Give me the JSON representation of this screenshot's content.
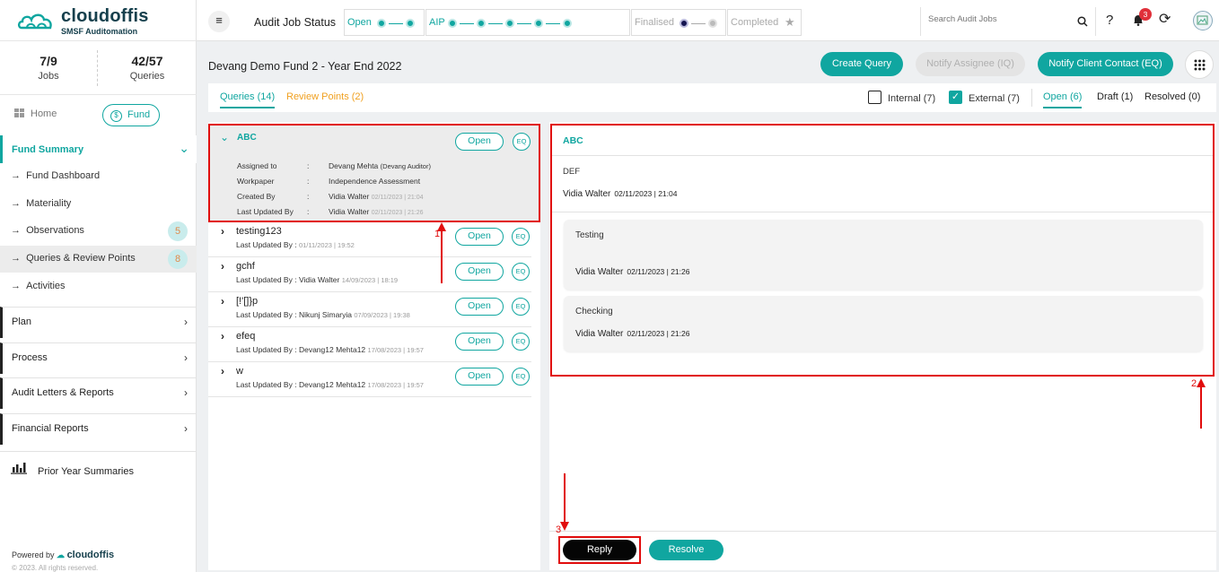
{
  "brand": {
    "name": "cloudoffis",
    "tagline": "SMSF Auditomation",
    "accent": "#10a6a0"
  },
  "sidebar": {
    "stats": [
      {
        "value": "7/9",
        "label": "Jobs"
      },
      {
        "value": "42/57",
        "label": "Queries"
      }
    ],
    "home_label": "Home",
    "fund_label": "Fund",
    "fund_summary_label": "Fund Summary",
    "sub_items": [
      {
        "label": "Fund Dashboard"
      },
      {
        "label": "Materiality"
      },
      {
        "label": "Observations",
        "count": "5"
      },
      {
        "label": "Queries & Review Points",
        "count": "8"
      },
      {
        "label": "Activities"
      }
    ],
    "sections": [
      {
        "label": "Plan"
      },
      {
        "label": "Process"
      },
      {
        "label": "Audit Letters & Reports"
      },
      {
        "label": "Financial Reports"
      }
    ],
    "prior_label": "Prior Year Summaries",
    "powered_by": "Powered by",
    "copyright": "© 2023. All rights reserved."
  },
  "topbar": {
    "title": "Audit Job Status",
    "stages": [
      "Open",
      "AIP",
      "Finalised",
      "Completed"
    ],
    "search_placeholder": "Search Audit Jobs",
    "notification_count": "3"
  },
  "page": {
    "title": "Devang Demo Fund 2 - Year End 2022",
    "buttons": {
      "create": "Create Query",
      "notify_assignee": "Notify Assignee (IQ)",
      "notify_client": "Notify Client Contact (EQ)"
    },
    "tabs": {
      "queries": "Queries (14)",
      "review": "Review Points (2)"
    },
    "filters": {
      "internal": "Internal (7)",
      "external": "External (7)",
      "open": "Open (6)",
      "draft": "Draft (1)",
      "resolved": "Resolved (0)"
    }
  },
  "list": {
    "open_label": "Open",
    "eq_label": "EQ",
    "expanded": {
      "title": "ABC",
      "fields": [
        {
          "label": "Assigned to",
          "value": "Devang Mehta",
          "extra": "(Devang Auditor)"
        },
        {
          "label": "Workpaper",
          "value": "Independence Assessment",
          "extra": ""
        },
        {
          "label": "Created By",
          "value": "Vidia Walter",
          "ts": "02/11/2023 | 21:04"
        },
        {
          "label": "Last Updated By",
          "value": "Vidia Walter",
          "ts": "02/11/2023 | 21:26"
        }
      ],
      "sep": ":"
    },
    "items": [
      {
        "title": "testing123",
        "meta": "Last Updated By :",
        "who": "",
        "ts": "01/11/2023 | 19:52"
      },
      {
        "title": "gchf",
        "meta": "Last Updated By :",
        "who": "Vidia Walter",
        "ts": "14/09/2023 | 18:19"
      },
      {
        "title": "[!'[]}p",
        "meta": "Last Updated By :",
        "who": "Nikunj Simaryia",
        "ts": "07/09/2023 | 19:38"
      },
      {
        "title": "efeq",
        "meta": "Last Updated By :",
        "who": "Devang12 Mehta12",
        "ts": "17/08/2023 | 19:57"
      },
      {
        "title": "w",
        "meta": "Last Updated By :",
        "who": "Devang12 Mehta12",
        "ts": "17/08/2023 | 19:57"
      }
    ]
  },
  "detail": {
    "title": "ABC",
    "body": "DEF",
    "author": "Vidia Walter",
    "author_ts": "02/11/2023 | 21:04",
    "replies": [
      {
        "text": "Testing",
        "who": "Vidia Walter",
        "ts": "02/11/2023 | 21:26"
      },
      {
        "text": "Checking",
        "who": "Vidia Walter",
        "ts": "02/11/2023 | 21:26"
      }
    ],
    "reply_label": "Reply",
    "resolve_label": "Resolve"
  },
  "annotations": {
    "one": "1",
    "two": "2",
    "three": "3"
  }
}
